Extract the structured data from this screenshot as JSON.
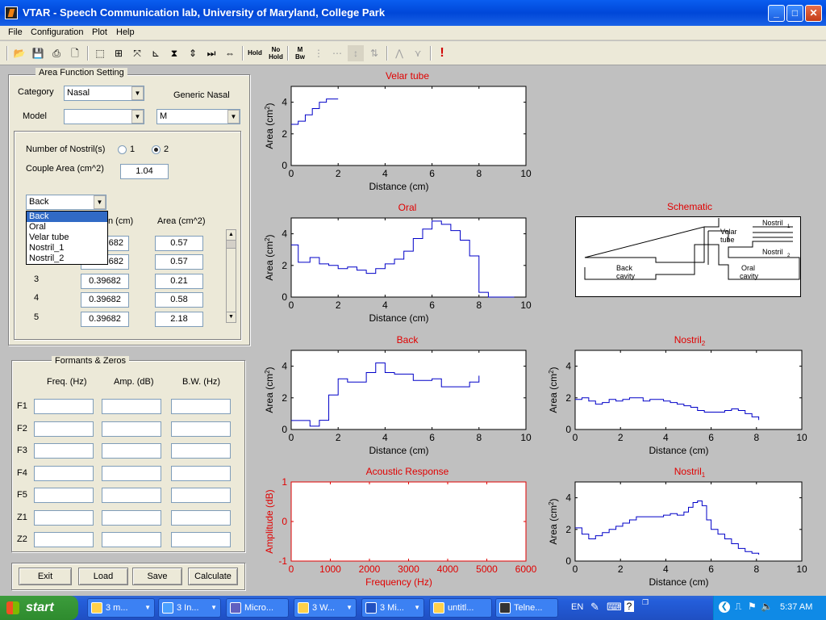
{
  "window": {
    "title": "VTAR  - Speech Communication lab, University of Maryland, College Park"
  },
  "menu": [
    "File",
    "Configuration",
    "Plot",
    "Help"
  ],
  "toolbar": {
    "hold": "Hold",
    "nohold": "No Hold",
    "mbw": "M Bw"
  },
  "area_panel": {
    "title": "Area Function Setting",
    "category_label": "Category",
    "category_value": "Nasal",
    "generic_label": "Generic Nasal",
    "model_label": "Model",
    "model_value": "",
    "generic_value": "M",
    "nostrils_label": "Number of Nostril(s)",
    "nostril_opt1": "1",
    "nostril_opt2": "2",
    "couple_label": "Couple Area (cm^2)",
    "couple_value": "1.04",
    "section_value": "Back",
    "section_options": [
      "Back",
      "Oral",
      "Velar tube",
      "Nostril_1",
      "Nostril_2"
    ],
    "len_header_partial": "n (cm)",
    "area_header": "Area (cm^2)",
    "rows": [
      {
        "n": "1",
        "len": "0.39682",
        "area": "0.57"
      },
      {
        "n": "2",
        "len": "0.39682",
        "area": "0.57"
      },
      {
        "n": "3",
        "len": "0.39682",
        "area": "0.21"
      },
      {
        "n": "4",
        "len": "0.39682",
        "area": "0.58"
      },
      {
        "n": "5",
        "len": "0.39682",
        "area": "2.18"
      }
    ],
    "len_visible_partial": [
      "682",
      "682"
    ]
  },
  "formant_panel": {
    "title": "Formants & Zeros",
    "headers": [
      "Freq. (Hz)",
      "Amp. (dB)",
      "B.W. (Hz)"
    ],
    "rows": [
      "F1",
      "F2",
      "F3",
      "F4",
      "F5",
      "Z1",
      "Z2"
    ]
  },
  "buttons": {
    "exit": "Exit",
    "load": "Load",
    "save": "Save",
    "calculate": "Calculate"
  },
  "schematic": {
    "title": "Schematic",
    "labels": {
      "nostril1": "Nostril",
      "nostril2": "Nostril",
      "sub1": "1",
      "sub2": "2",
      "velar1": "Velar",
      "velar2": "tube",
      "back1": "Back",
      "back2": "cavity",
      "oral1": "Oral",
      "oral2": "cavity"
    }
  },
  "chart_data": [
    {
      "type": "line",
      "title": "Velar tube",
      "xlabel": "Distance (cm)",
      "ylabel": "Area (cm2)",
      "xlim": [
        0,
        10
      ],
      "ylim": [
        0,
        5
      ],
      "xticks": [
        0,
        2,
        4,
        6,
        8,
        10
      ],
      "yticks": [
        0,
        2,
        4
      ],
      "step": true,
      "series": [
        {
          "x": [
            0,
            0.3,
            0.6,
            0.9,
            1.2,
            1.5,
            2.0
          ],
          "y": [
            2.6,
            2.8,
            3.2,
            3.6,
            4.0,
            4.2,
            4.2
          ]
        }
      ]
    },
    {
      "type": "line",
      "title": "Oral",
      "xlabel": "Distance (cm)",
      "ylabel": "Area (cm2)",
      "xlim": [
        0,
        10
      ],
      "ylim": [
        0,
        5
      ],
      "xticks": [
        0,
        2,
        4,
        6,
        8,
        10
      ],
      "yticks": [
        0,
        2,
        4
      ],
      "step": true,
      "series": [
        {
          "x": [
            0,
            0.3,
            0.8,
            1.2,
            1.6,
            2.0,
            2.4,
            2.8,
            3.2,
            3.6,
            4.0,
            4.4,
            4.8,
            5.2,
            5.6,
            6.0,
            6.4,
            6.8,
            7.2,
            7.6,
            8.0,
            8.4,
            9.5
          ],
          "y": [
            3.3,
            2.2,
            2.5,
            2.1,
            2.0,
            1.8,
            1.9,
            1.7,
            1.5,
            1.8,
            2.1,
            2.4,
            2.9,
            3.7,
            4.3,
            4.8,
            4.6,
            4.2,
            3.6,
            2.6,
            0.3,
            0.0,
            0.0
          ]
        }
      ]
    },
    {
      "type": "line",
      "title": "Back",
      "xlabel": "Distance (cm)",
      "ylabel": "Area (cm2)",
      "xlim": [
        0,
        10
      ],
      "ylim": [
        0,
        5
      ],
      "xticks": [
        0,
        2,
        4,
        6,
        8,
        10
      ],
      "yticks": [
        0,
        2,
        4
      ],
      "step": true,
      "series": [
        {
          "x": [
            0,
            0.8,
            1.2,
            1.6,
            2.0,
            2.4,
            2.8,
            3.2,
            3.6,
            4.0,
            4.4,
            4.8,
            5.2,
            5.6,
            6.0,
            6.4,
            6.8,
            7.2,
            7.6,
            8.0
          ],
          "y": [
            0.57,
            0.21,
            0.58,
            2.18,
            3.2,
            3.0,
            3.0,
            3.6,
            4.2,
            3.6,
            3.5,
            3.5,
            3.1,
            3.1,
            3.2,
            2.7,
            2.7,
            2.7,
            3.0,
            3.4
          ]
        }
      ]
    },
    {
      "type": "line",
      "title": "Nostril_2",
      "xlabel": "Distance (cm)",
      "ylabel": "Area (cm2)",
      "xlim": [
        0,
        10
      ],
      "ylim": [
        0,
        5
      ],
      "xticks": [
        0,
        2,
        4,
        6,
        8,
        10
      ],
      "yticks": [
        0,
        2,
        4
      ],
      "step": true,
      "series": [
        {
          "x": [
            0,
            0.3,
            0.6,
            0.9,
            1.2,
            1.5,
            1.8,
            2.1,
            2.4,
            2.7,
            3.0,
            3.3,
            3.6,
            3.9,
            4.2,
            4.5,
            4.8,
            5.1,
            5.4,
            5.7,
            6.0,
            6.3,
            6.6,
            6.9,
            7.2,
            7.5,
            7.8,
            8.1
          ],
          "y": [
            1.9,
            2.0,
            1.8,
            1.6,
            1.7,
            1.9,
            1.8,
            1.9,
            2.0,
            2.0,
            1.8,
            1.9,
            1.9,
            1.8,
            1.7,
            1.6,
            1.5,
            1.4,
            1.2,
            1.1,
            1.1,
            1.1,
            1.2,
            1.3,
            1.2,
            1.0,
            0.8,
            0.6
          ]
        }
      ]
    },
    {
      "type": "line",
      "title": "Acoustic Response",
      "xlabel": "Frequency (Hz)",
      "ylabel": "Amplitude (dB)",
      "xlim": [
        0,
        6000
      ],
      "ylim": [
        -1,
        1
      ],
      "xticks": [
        0,
        1000,
        2000,
        3000,
        4000,
        5000,
        6000
      ],
      "yticks": [
        -1,
        0,
        1
      ],
      "series": []
    },
    {
      "type": "line",
      "title": "Nostril_1",
      "xlabel": "Distance (cm)",
      "ylabel": "Area (cm2)",
      "xlim": [
        0,
        10
      ],
      "ylim": [
        0,
        5
      ],
      "xticks": [
        0,
        2,
        4,
        6,
        8,
        10
      ],
      "yticks": [
        0,
        2,
        4
      ],
      "step": true,
      "series": [
        {
          "x": [
            0,
            0.3,
            0.6,
            0.9,
            1.2,
            1.5,
            1.8,
            2.1,
            2.4,
            2.7,
            3.0,
            3.3,
            3.6,
            3.9,
            4.2,
            4.5,
            4.8,
            5.0,
            5.2,
            5.4,
            5.6,
            5.8,
            6.0,
            6.3,
            6.6,
            6.9,
            7.2,
            7.5,
            7.8,
            8.1
          ],
          "y": [
            2.1,
            1.7,
            1.4,
            1.6,
            1.8,
            2.0,
            2.2,
            2.4,
            2.6,
            2.8,
            2.8,
            2.8,
            2.8,
            2.9,
            3.0,
            2.9,
            3.1,
            3.4,
            3.7,
            3.8,
            3.5,
            2.6,
            2.0,
            1.7,
            1.4,
            1.1,
            0.8,
            0.6,
            0.5,
            0.4
          ]
        }
      ]
    }
  ],
  "taskbar": {
    "start": "start",
    "tasks": [
      "3 m...",
      "3 In...",
      "Micro...",
      "3 W...",
      "3 Mi...",
      "untitl...",
      "Telne..."
    ],
    "lang": "EN",
    "time": "5:37 AM"
  }
}
